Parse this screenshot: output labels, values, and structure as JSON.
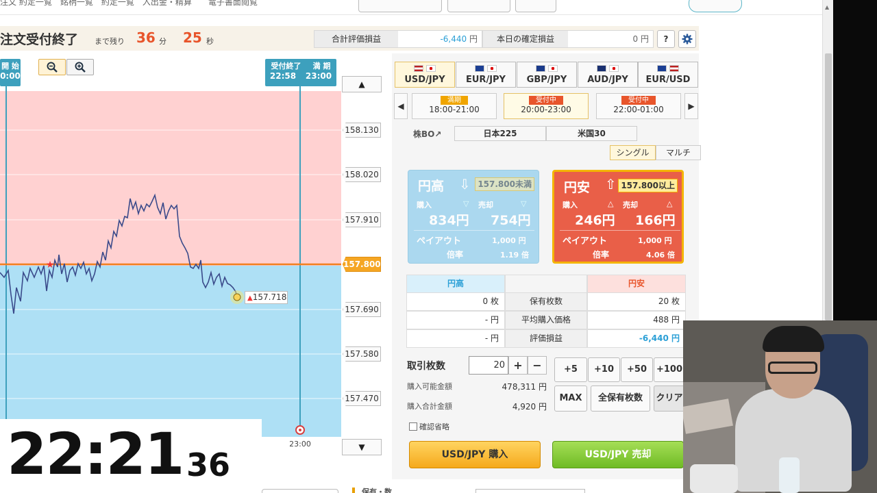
{
  "nav": {
    "items_text": "注文 約定一覧　銘柄一覧　約定一覧　入出金・精算　　電子書面閲覧"
  },
  "header": {
    "title": "注文受付終了",
    "remaining_label": "まで残り",
    "minutes": "36",
    "minutes_unit": "分",
    "seconds": "25",
    "seconds_unit": "秒",
    "total_pl_label": "合計評価損益",
    "total_pl_value": "-6,440",
    "today_pl_label": "本日の確定損益",
    "today_pl_value": "0",
    "yen": "円",
    "help_label": "?"
  },
  "chart": {
    "tag_start_top": "開 始",
    "tag_start_time": "0:00",
    "tag_end_label1": "受付終了",
    "tag_end_label2": "満 期",
    "tag_end_time1": "22:58",
    "tag_end_time2": "23:00",
    "x_label": "23:00",
    "target_price": "157.800",
    "current_price": "157.718",
    "price_ticks": [
      "158.130",
      "158.020",
      "157.910",
      "157.800",
      "157.690",
      "157.580",
      "157.470"
    ],
    "up_arrow": "▲",
    "down_arrow": "▼",
    "colors": {
      "upper_zone": "#ffd1d1",
      "lower_zone": "#aee0f5",
      "line": "#3a4a8a",
      "target": "#f08020"
    }
  },
  "clock": {
    "hm": "22:21",
    "sec": "36"
  },
  "pairs": [
    {
      "label": "USD/JPY",
      "selected": true
    },
    {
      "label": "EUR/JPY",
      "selected": false
    },
    {
      "label": "GBP/JPY",
      "selected": false
    },
    {
      "label": "AUD/JPY",
      "selected": false
    },
    {
      "label": "EUR/USD",
      "selected": false
    }
  ],
  "slots": [
    {
      "status": "満期",
      "time": "18:00-21:00"
    },
    {
      "status": "受付中",
      "time": "20:00-23:00"
    },
    {
      "status": "受付中",
      "time": "22:00-01:00"
    }
  ],
  "stock_bo": {
    "label": "株BO↗",
    "tab1": "日本225",
    "tab2": "米国30"
  },
  "mode": {
    "single": "シングル",
    "multi": "マルチ"
  },
  "high_card": {
    "title": "円高",
    "condition": "157.800未満",
    "buy_label": "購入",
    "sell_label": "売却",
    "buy_price": "834円",
    "sell_price": "754円",
    "payout_label": "ペイアウト",
    "payout_value": "1,000 円",
    "ratio_label": "倍率",
    "ratio_value": "1.19 倍"
  },
  "low_card": {
    "title": "円安",
    "condition": "157.800以上",
    "buy_label": "購入",
    "sell_label": "売却",
    "buy_price": "246円",
    "sell_price": "166円",
    "payout_label": "ペイアウト",
    "payout_value": "1,000 円",
    "ratio_label": "倍率",
    "ratio_value": "4.06 倍"
  },
  "holdings": {
    "col_high": "円高",
    "col_low": "円安",
    "rows": [
      {
        "label": "保有枚数",
        "high": "0 枚",
        "low": "20 枚"
      },
      {
        "label": "平均購入価格",
        "high": "- 円",
        "low": "488 円"
      },
      {
        "label": "評価損益",
        "high": "- 円",
        "low": "-6,440 円"
      }
    ]
  },
  "order": {
    "qty_label": "取引枚数",
    "qty_value": "20",
    "plus": "+",
    "minus": "−",
    "avail_label": "購入可能金額",
    "avail_value": "478,311 円",
    "total_label": "購入合計金額",
    "total_value": "4,920 円",
    "quick": [
      "+5",
      "+10",
      "+50",
      "+100"
    ],
    "max": "MAX",
    "all_hold": "全保有枚数",
    "clear": "クリア",
    "skip_confirm": "確認省略",
    "buy_button": "USD/JPY 購入",
    "sell_button": "USD/JPY 売却"
  },
  "bottom": {
    "frag": "保有・数"
  }
}
